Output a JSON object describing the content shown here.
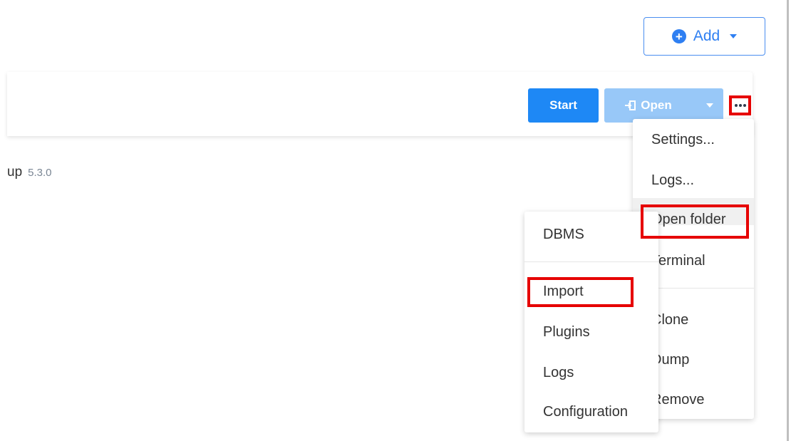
{
  "header": {
    "add_button": {
      "label": "Add",
      "icon": "plus-circle-icon",
      "caret": "caret-down-icon"
    }
  },
  "card": {
    "start_button": "Start",
    "open_button": {
      "label": "Open",
      "icon": "sign-in-icon",
      "caret": "caret-down-icon"
    },
    "more_button_icon": "ellipsis-icon"
  },
  "project": {
    "name_fragment": "up",
    "version": "5.3.0"
  },
  "context_menu": {
    "items": [
      "Settings...",
      "Logs...",
      "Open folder",
      "Terminal",
      "Clone",
      "Dump",
      "Remove"
    ]
  },
  "dbms_menu": {
    "items": [
      "DBMS",
      "Import",
      "Plugins",
      "Logs",
      "Configuration"
    ]
  },
  "colors": {
    "primary": "#1e88f5",
    "primary_disabled": "#98c8f8",
    "annotation_red": "#e60000"
  }
}
